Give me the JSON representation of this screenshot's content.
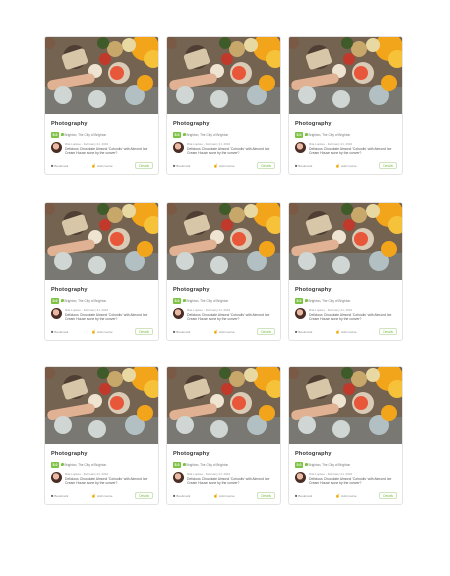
{
  "cards": [
    {
      "title": "Photography",
      "rating": "5.0",
      "location": "Brighton, The City of Brighton",
      "reviewer": "Rita Lopkee",
      "date": "February 21, 2016",
      "review": "Delicious Chocolate Almond 'Cohoolis' with Almond Ice Cream House sone by the conver?",
      "bookmark": "Bookmark",
      "helpful": "Add course",
      "details": "Details"
    },
    {
      "title": "Photography",
      "rating": "5.0",
      "location": "Brighton, The City of Brighton",
      "reviewer": "Rita Lopkee",
      "date": "February 21, 2016",
      "review": "Delicious Chocolate Almond 'Cohoolis' with Almond Ice Cream House sone by the conver?",
      "bookmark": "Bookmark",
      "helpful": "Add course",
      "details": "Details"
    },
    {
      "title": "Photography",
      "rating": "5.0",
      "location": "Brighton, The City of Brighton",
      "reviewer": "Rita Lopkee",
      "date": "February 21, 2016",
      "review": "Delicious Chocolate Almond 'Cohoolis' with Almond Ice Cream House sone by the conver?",
      "bookmark": "Bookmark",
      "helpful": "Add course",
      "details": "Details"
    },
    {
      "title": "Photography",
      "rating": "5.0",
      "location": "Brighton, The City of Brighton",
      "reviewer": "Rita Lopkee",
      "date": "February 21, 2016",
      "review": "Delicious Chocolate Almond 'Cohoolis' with Almond Ice Cream House sone by the conver?",
      "bookmark": "Bookmark",
      "helpful": "Add course",
      "details": "Details"
    },
    {
      "title": "Photography",
      "rating": "5.0",
      "location": "Brighton, The City of Brighton",
      "reviewer": "Rita Lopkee",
      "date": "February 21, 2016",
      "review": "Delicious Chocolate Almond 'Cohoolis' with Almond Ice Cream House sone by the conver?",
      "bookmark": "Bookmark",
      "helpful": "Add course",
      "details": "Details"
    },
    {
      "title": "Photography",
      "rating": "5.0",
      "location": "Brighton, The City of Brighton",
      "reviewer": "Rita Lopkee",
      "date": "February 21, 2016",
      "review": "Delicious Chocolate Almond 'Cohoolis' with Almond Ice Cream House sone by the conver?",
      "bookmark": "Bookmark",
      "helpful": "Add course",
      "details": "Details"
    },
    {
      "title": "Photography",
      "rating": "5.0",
      "location": "Brighton, The City of Brighton",
      "reviewer": "Rita Lopkee",
      "date": "February 21, 2016",
      "review": "Delicious Chocolate Almond 'Cohoolis' with Almond Ice Cream House sone by the conver?",
      "bookmark": "Bookmark",
      "helpful": "Add course",
      "details": "Details"
    },
    {
      "title": "Photography",
      "rating": "5.0",
      "location": "Brighton, The City of Brighton",
      "reviewer": "Rita Lopkee",
      "date": "February 21, 2016",
      "review": "Delicious Chocolate Almond 'Cohoolis' with Almond Ice Cream House sone by the conver?",
      "bookmark": "Bookmark",
      "helpful": "Add course",
      "details": "Details"
    },
    {
      "title": "Photography",
      "rating": "5.0",
      "location": "Brighton, The City of Brighton",
      "reviewer": "Rita Lopkee",
      "date": "February 21, 2016",
      "review": "Delicious Chocolate Almond 'Cohoolis' with Almond Ice Cream House sone by the conver?",
      "bookmark": "Bookmark",
      "helpful": "Add course",
      "details": "Details"
    }
  ],
  "colors": {
    "accent": "#7cc243",
    "border": "#e3e3e3",
    "text": "#333333"
  },
  "icons": {
    "bookmark": "bookmark-icon",
    "helpful": "thumbs-up-icon",
    "location": "map-pin-icon"
  }
}
